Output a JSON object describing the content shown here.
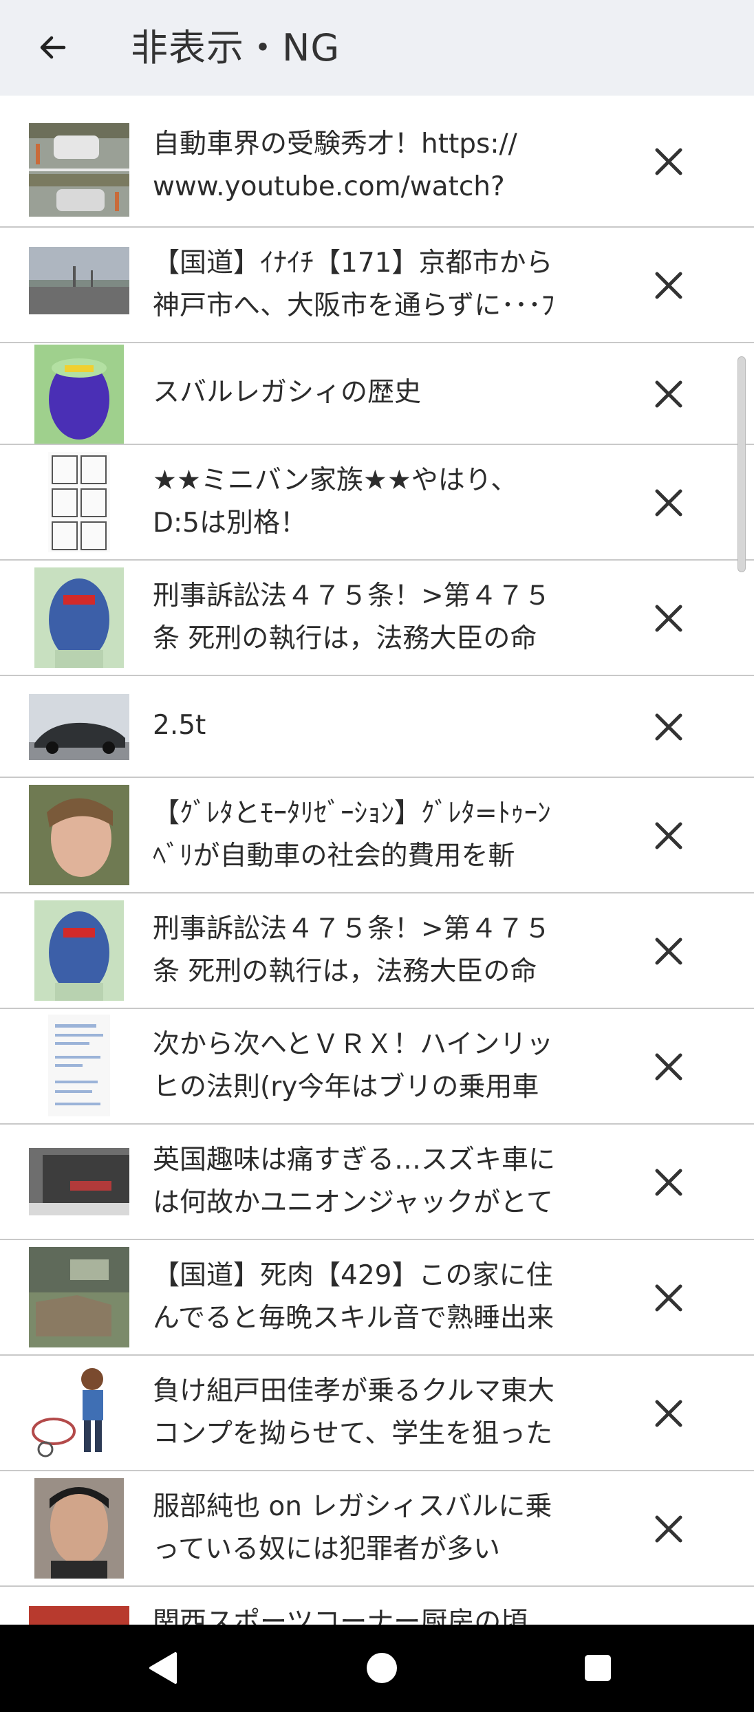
{
  "app_bar": {
    "title": "非表示・NG"
  },
  "items": [
    {
      "line1": "自動車界の受験秀才！https://",
      "line2": "www.youtube.com/watch?"
    },
    {
      "line1": "【国道】ｲﾅｲﾁ【171】京都市から",
      "line2": "神戸市へ、大阪市を通らずに･･･ﾌ"
    },
    {
      "line1": "スバルレガシィの歴史",
      "line2": ""
    },
    {
      "line1": "★★ミニバン家族★★やはり、",
      "line2": "D:5は別格！"
    },
    {
      "line1": "刑事訴訟法４７５条！>第４７５",
      "line2": "条 死刑の執行は，法務大臣の命"
    },
    {
      "line1": "2.5t",
      "line2": ""
    },
    {
      "line1": "【ｸﾞﾚﾀとﾓｰﾀﾘｾﾞｰｼｮﾝ】ｸﾞﾚﾀ=ﾄｩｰﾝ",
      "line2": "ﾍﾞﾘが自動車の社会的費用を斬"
    },
    {
      "line1": "刑事訴訟法４７５条！>第４７５",
      "line2": "条 死刑の執行は，法務大臣の命"
    },
    {
      "line1": "次から次へとＶＲＸ！ハインリッ",
      "line2": "ヒの法則(ry今年はブリの乗用車"
    },
    {
      "line1": "英国趣味は痛すぎる…スズキ車に",
      "line2": "は何故かユニオンジャックがとて"
    },
    {
      "line1": "【国道】死肉【429】この家に住",
      "line2": "んでると毎晩スキル音で熟睡出来"
    },
    {
      "line1": "負け組戸田佳孝が乗るクルマ東大",
      "line2": "コンプを拗らせて、学生を狙った"
    },
    {
      "line1": "服部純也 on レガシィスバルに乗",
      "line2": "っている奴には犯罪者が多い"
    },
    {
      "line1": "関西スポーツコーナー厨房の頃",
      "line2": ""
    }
  ],
  "colors": {
    "app_bar_bg": "#eef0f4",
    "divider": "#c9c9c9",
    "nav_bar_bg": "#000000"
  },
  "icons": {
    "back": "arrow-back-icon",
    "remove": "close-icon",
    "nav": [
      "nav-back-icon",
      "nav-home-icon",
      "nav-recents-icon"
    ]
  }
}
